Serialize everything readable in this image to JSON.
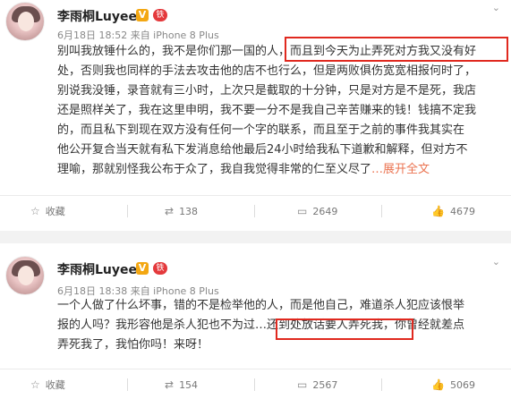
{
  "posts": [
    {
      "author": "李雨桐Luyee",
      "verified_badge": "V",
      "fan_badge": "铁",
      "meta": "6月18日 18:52 来自 iPhone 8 Plus",
      "lines": [
        "别叫我放锤什么的，我不是你们那一国的人，而且到今天为止弄死对方我又没有好",
        "处，否则我也同样的手法去攻击他的店不也行么，但是两败俱伤宽宽相报何时了，",
        "别说我没锤，录音就有三小时，上次只是截取的十分钟，只是对方是不是死，我店",
        "还是照样关了，我在这里申明，我不要一分不是我自己辛苦赚来的钱！钱搞不定我",
        "的，而且私下到现在双方没有任何一个字的联系，而且至于之前的事件我其实在",
        "他公开复合当天就有私下发消息给他最后24小时给我私下道歉和解释，但对方不"
      ],
      "last_line": "理喻，那就别怪我公布于众了，我自我觉得非常的仁至义尽了",
      "more": "…展开全文",
      "actions": {
        "favorite": "收藏",
        "repost": "138",
        "comment": "2649",
        "like": "4679"
      }
    },
    {
      "author": "李雨桐Luyee",
      "verified_badge": "V",
      "fan_badge": "铁",
      "meta": "6月18日 18:38 来自 iPhone 8 Plus",
      "lines": [
        "一个人做了什么坏事，错的不是检举他的人，而是他自己，难道杀人犯应该恨举",
        "报的人吗？我形容他是杀人犯也不为过…还到处放话要人弄死我，你曾经就差点",
        "弄死我了，我怕你吗！来呀！"
      ],
      "actions": {
        "favorite": "收藏",
        "repost": "154",
        "comment": "2567",
        "like": "5069"
      }
    }
  ],
  "colors": {
    "highlight": "#e0291f",
    "link": "#eb7350"
  },
  "icons": {
    "favorite": "star-icon",
    "repost": "repost-icon",
    "comment": "comment-icon",
    "like": "thumbs-up-icon",
    "caret": "chevron-down-icon"
  }
}
